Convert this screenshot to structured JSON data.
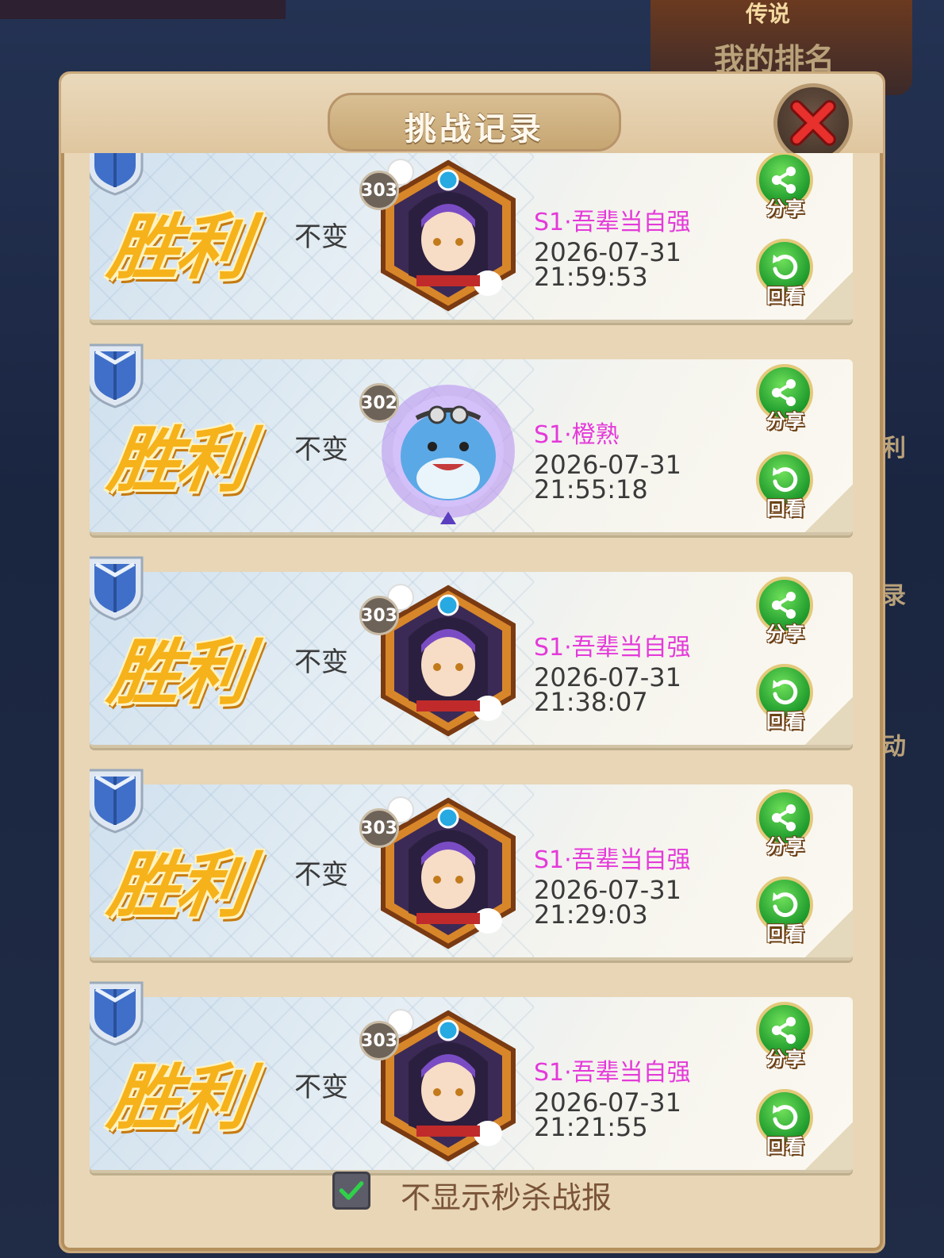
{
  "background": {
    "top_label": "传说",
    "my_rank_label": "我的排名",
    "side_labels": [
      "利",
      "录",
      "动"
    ]
  },
  "dialog": {
    "title": "挑战记录",
    "close_icon": "close-x-icon"
  },
  "records": [
    {
      "result": "胜利",
      "rank_change": "不变",
      "level": "303",
      "avatar": "purple-hair-girl-avatar",
      "opponent": "S1·吾辈当自强",
      "date": "2026-07-31",
      "time": "21:59:53",
      "share_label": "分享",
      "replay_label": "回看"
    },
    {
      "result": "胜利",
      "rank_change": "不变",
      "level": "302",
      "avatar": "blue-shark-avatar",
      "opponent": "S1·橙熟",
      "date": "2026-07-31",
      "time": "21:55:18",
      "share_label": "分享",
      "replay_label": "回看"
    },
    {
      "result": "胜利",
      "rank_change": "不变",
      "level": "303",
      "avatar": "purple-hair-girl-avatar",
      "opponent": "S1·吾辈当自强",
      "date": "2026-07-31",
      "time": "21:38:07",
      "share_label": "分享",
      "replay_label": "回看"
    },
    {
      "result": "胜利",
      "rank_change": "不变",
      "level": "303",
      "avatar": "purple-hair-girl-avatar",
      "opponent": "S1·吾辈当自强",
      "date": "2026-07-31",
      "time": "21:29:03",
      "share_label": "分享",
      "replay_label": "回看"
    },
    {
      "result": "胜利",
      "rank_change": "不变",
      "level": "303",
      "avatar": "purple-hair-girl-avatar",
      "opponent": "S1·吾辈当自强",
      "date": "2026-07-31",
      "time": "21:21:55",
      "share_label": "分享",
      "replay_label": "回看"
    }
  ],
  "footer": {
    "checkbox_checked": true,
    "checkbox_label": "不显示秒杀战报"
  },
  "colors": {
    "win_gold": "#f6b21a",
    "opponent_name": "#e43ad9",
    "button_green": "#1d9a2c",
    "panel_bg": "#e8d6b6"
  }
}
